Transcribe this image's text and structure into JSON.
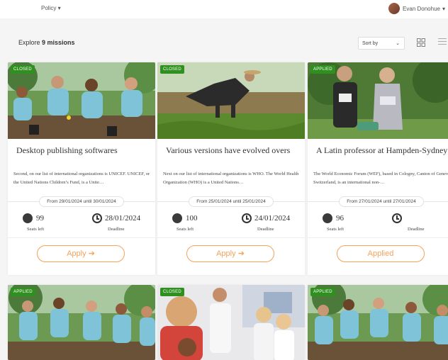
{
  "header": {
    "policy_label": "Policy",
    "policy_chevron": "▾",
    "user_name": "Evan Donohue",
    "user_chevron": "▾"
  },
  "toolbar": {
    "explore_prefix": "Explore",
    "explore_count": "9 missions",
    "sort_label": "Sort by",
    "sort_chevron": "⌄"
  },
  "cards": [
    {
      "badge": "CLOSED",
      "title": "Desktop publishing softwares",
      "desc": "Second, on our list of international organizations is UNICEF. UNICEF, or the United Nations Children’s Fund, is a Unite…",
      "dates": "From 29/01/2024 until 30/01/2024",
      "seats": "99",
      "seats_label": "Seats left",
      "deadline": "28/01/2024",
      "deadline_label": "Deadline",
      "button": "Apply",
      "button_arrow": "➔"
    },
    {
      "badge": "CLOSED",
      "title": "Various versions have evolved overs",
      "desc": "Next on our list of international organizations is WHO. The World Health Organization (WHO) is a United Nations…",
      "dates": "From 25/01/2024 until 25/01/2024",
      "seats": "100",
      "seats_label": "Seats left",
      "deadline": "24/01/2024",
      "deadline_label": "Deadline",
      "button": "Apply",
      "button_arrow": "➔"
    },
    {
      "badge": "APPLIED",
      "title": "A Latin professor at Hampden-Sydney",
      "desc": "The World Economic Forum (WEF), based in Cologny, Canton of Geneva, Switzerland, is an international non-…",
      "dates": "From 27/01/2024 until 27/01/2024",
      "seats": "96",
      "seats_label": "Seats left",
      "deadline": "",
      "deadline_label": "Deadline",
      "button": "Applied",
      "button_arrow": ""
    },
    {
      "badge": "APPLIED"
    },
    {
      "badge": "CLOSED"
    },
    {
      "badge": "APPLIED"
    }
  ],
  "colors": {
    "accent": "#f5a25a",
    "badge_green": "#2f8f1f"
  }
}
